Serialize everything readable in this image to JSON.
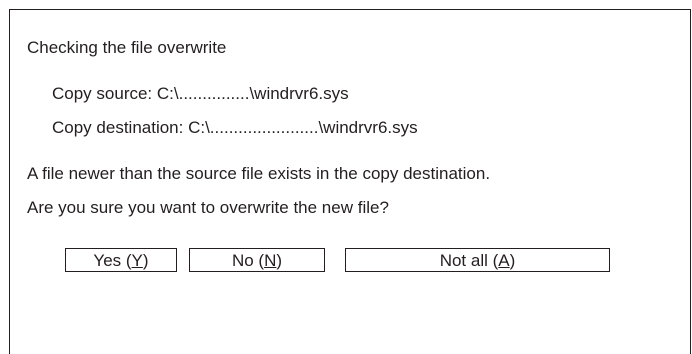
{
  "dialog": {
    "title": "Checking the file overwrite",
    "copy_source": "Copy source: C:\\...............\\windrvr6.sys",
    "copy_destination": "Copy destination: C:\\.......................\\windrvr6.sys",
    "message_line1": "A file newer than the source file exists in the copy destination.",
    "message_line2": "Are you sure you want to overwrite the new file?"
  },
  "buttons": {
    "yes": {
      "prefix": "Yes (",
      "accel": "Y",
      "suffix": ")"
    },
    "no": {
      "prefix": "No (",
      "accel": "N",
      "suffix": ")"
    },
    "not_all": {
      "prefix": "Not all (",
      "accel": "A",
      "suffix": ")"
    }
  }
}
